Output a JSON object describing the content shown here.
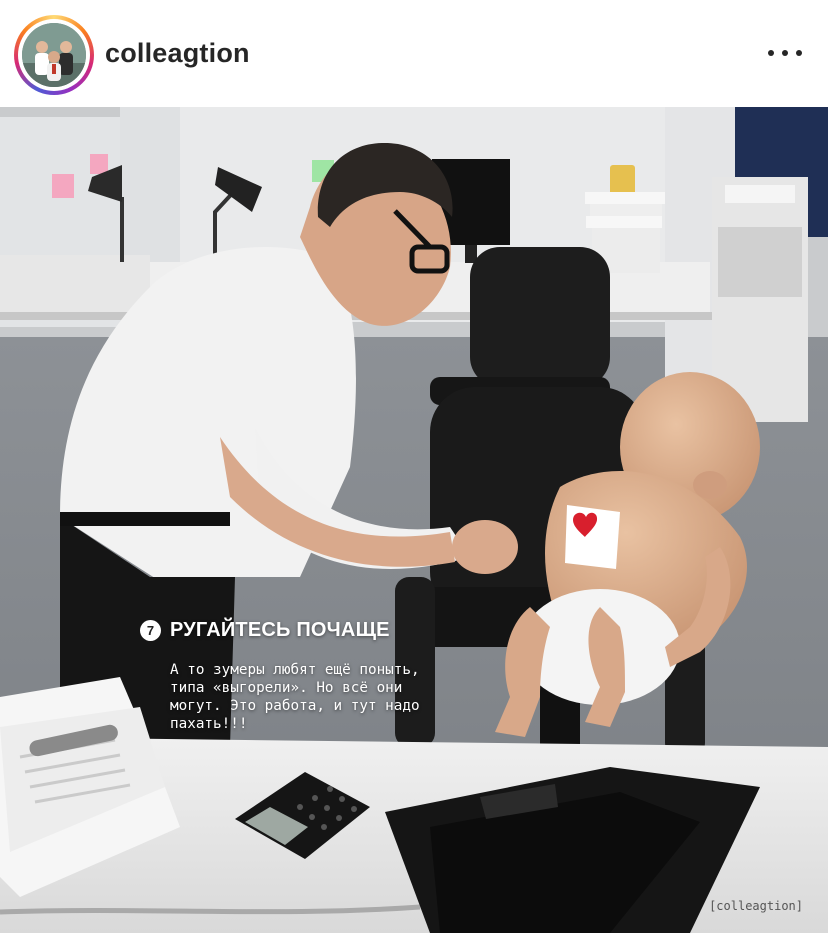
{
  "header": {
    "username": "colleagtion",
    "avatar_icon": "team-avatar-icon",
    "more_icon": "more-dots-icon"
  },
  "post": {
    "step_number": "7",
    "title": "РУГАЙТЕСЬ ПОЧАЩЕ",
    "body": "А то зумеры любят ещё поныть,\nтипа «выгорели». Но всё они\nмогут. Это работа, и тут надо\nпахать!!!",
    "watermark": "[colleagtion]"
  },
  "colors": {
    "story_ring": [
      "#feda75",
      "#fa7e1e",
      "#d62976",
      "#962fbf",
      "#4f5bd5"
    ],
    "text_dark": "#262626"
  }
}
